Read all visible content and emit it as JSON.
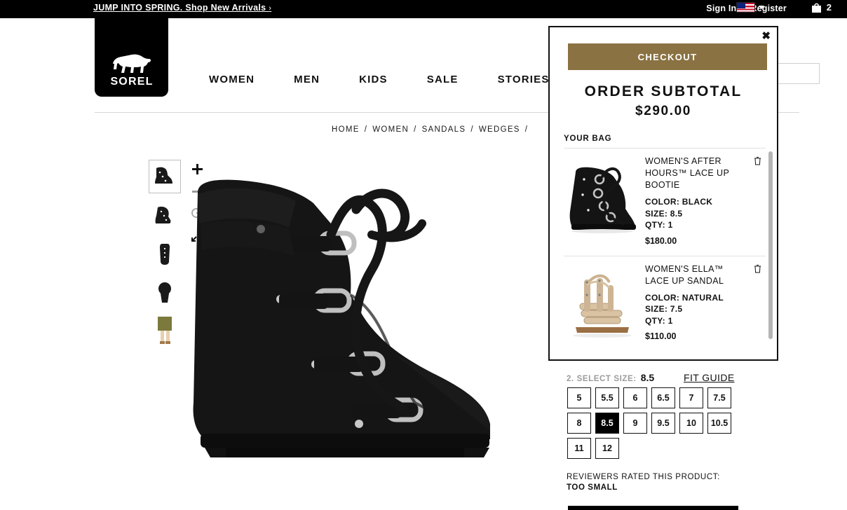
{
  "topbar": {
    "promo": "JUMP INTO SPRING. Shop New Arrivals",
    "promo_chevron": "›",
    "sign_in": "Sign In",
    "register": "Register",
    "locale_flag": "us-flag-icon",
    "bag_count": "2"
  },
  "header": {
    "logo_text": "SOREL",
    "nav": [
      {
        "label": "WOMEN"
      },
      {
        "label": "MEN"
      },
      {
        "label": "KIDS"
      },
      {
        "label": "SALE"
      },
      {
        "label": "STORIES"
      }
    ]
  },
  "breadcrumb": {
    "items": [
      "HOME",
      "WOMEN",
      "SANDALS",
      "WEDGES"
    ],
    "separator": "/",
    "trailing_separator": "/"
  },
  "gallery": {
    "thumbnails": [
      {
        "name": "bootie-side-view",
        "selected": true
      },
      {
        "name": "bootie-angle-view",
        "selected": false
      },
      {
        "name": "bootie-front-view",
        "selected": false
      },
      {
        "name": "bootie-sole-view",
        "selected": false
      },
      {
        "name": "bootie-lifestyle-view",
        "selected": false
      }
    ],
    "tools": [
      {
        "name": "zoom-in-icon",
        "glyph": "+"
      },
      {
        "name": "zoom-out-icon",
        "glyph": "−"
      },
      {
        "name": "rotate-icon",
        "glyph": "↺"
      },
      {
        "name": "fullscreen-icon",
        "glyph": "⤢"
      }
    ]
  },
  "size_selector": {
    "step_label": "2. SELECT SIZE:",
    "selected_size": "8.5",
    "fit_guide": "FIT GUIDE",
    "sizes": [
      {
        "label": "5",
        "selected": false
      },
      {
        "label": "5.5",
        "selected": false
      },
      {
        "label": "6",
        "selected": false
      },
      {
        "label": "6.5",
        "selected": false
      },
      {
        "label": "7",
        "selected": false
      },
      {
        "label": "7.5",
        "selected": false
      },
      {
        "label": "8",
        "selected": false
      },
      {
        "label": "8.5",
        "selected": true
      },
      {
        "label": "9",
        "selected": false
      },
      {
        "label": "9.5",
        "selected": false
      },
      {
        "label": "10",
        "selected": false
      },
      {
        "label": "10.5",
        "selected": false
      },
      {
        "label": "11",
        "selected": false
      },
      {
        "label": "12",
        "selected": false
      }
    ],
    "reviewers_label": "REVIEWERS RATED THIS PRODUCT:",
    "reviewers_value": "TOO SMALL"
  },
  "cart_flyout": {
    "close_glyph": "✖",
    "checkout_label": "CHECKOUT",
    "checkout_color": "#8a7242",
    "subtotal_label": "ORDER SUBTOTAL",
    "subtotal_value": "$290.00",
    "your_bag_label": "YOUR BAG",
    "items": [
      {
        "name": "WOMEN'S AFTER HOURS™ LACE UP BOOTIE",
        "color": "COLOR: BLACK",
        "size": "SIZE: 8.5",
        "qty": "QTY: 1",
        "price": "$180.00",
        "image": "black-wedge-bootie-thumb",
        "remove": "trash-icon"
      },
      {
        "name": "WOMEN'S ELLA™ LACE UP SANDAL",
        "color": "COLOR: NATURAL",
        "size": "SIZE: 7.5",
        "qty": "QTY: 1",
        "price": "$110.00",
        "image": "natural-gladiator-sandal-thumb",
        "remove": "trash-icon"
      }
    ]
  }
}
